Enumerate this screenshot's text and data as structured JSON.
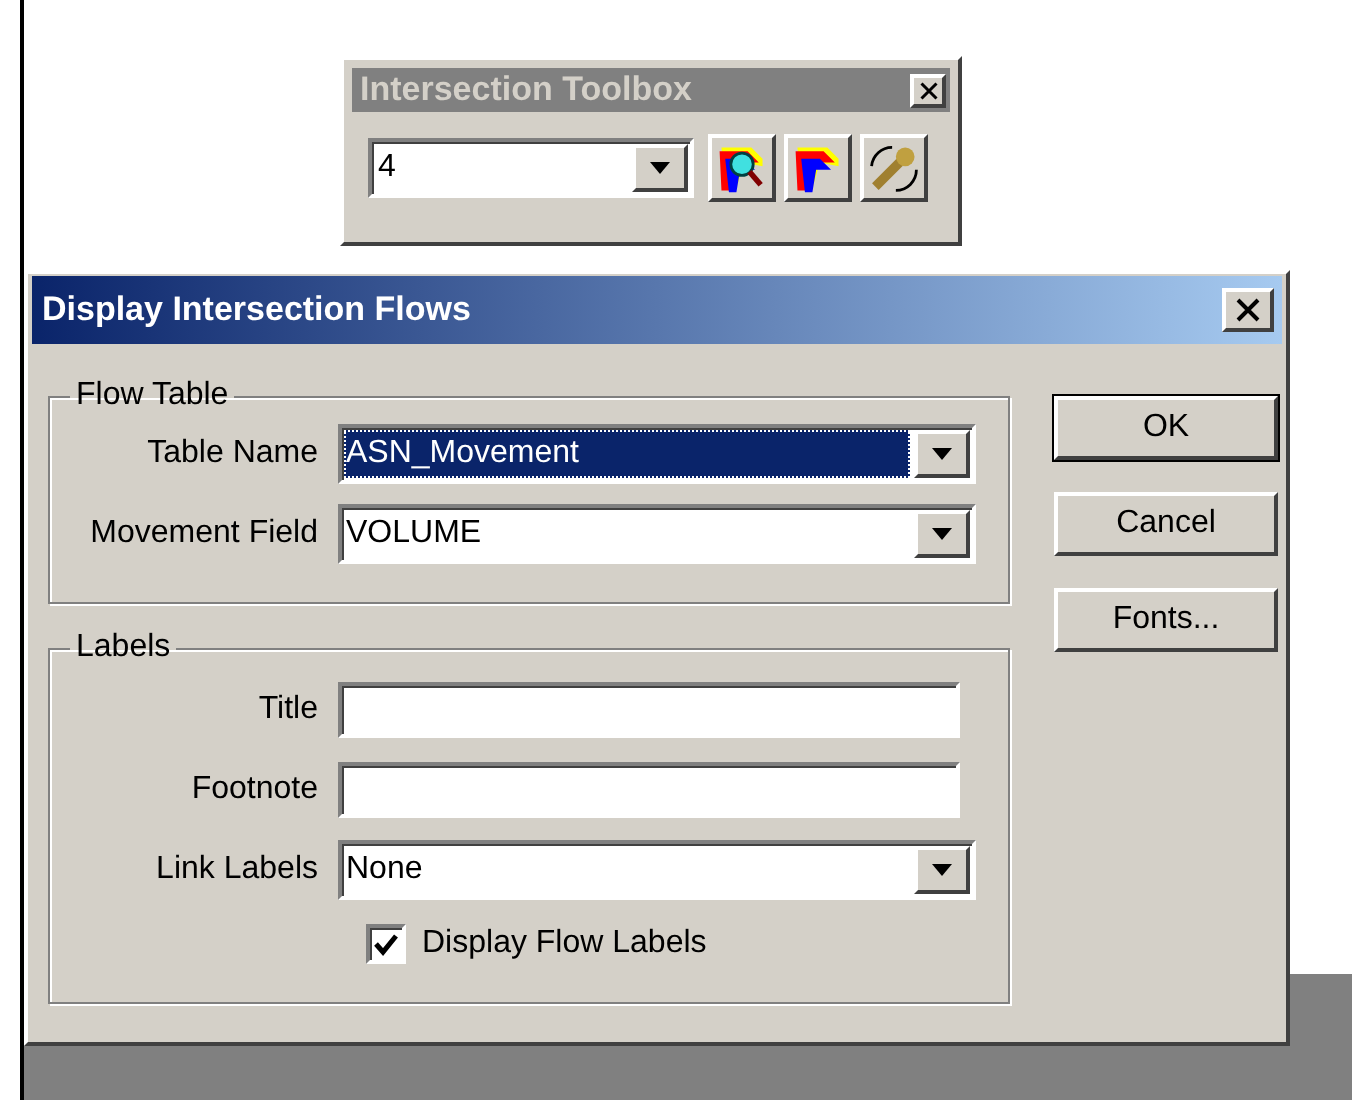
{
  "toolbox": {
    "title": "Intersection Toolbox",
    "combo": {
      "value": "4"
    }
  },
  "dialog": {
    "title": "Display Intersection Flows",
    "flow_table": {
      "legend": "Flow Table",
      "fields": [
        {
          "kind": "combo",
          "label": "Table Name",
          "value": "ASN_Movement",
          "focused": true
        },
        {
          "kind": "combo",
          "label": "Movement Field",
          "value": "VOLUME",
          "focused": false
        }
      ]
    },
    "labels": {
      "legend": "Labels",
      "fields": [
        {
          "kind": "text",
          "label": "Title"
        },
        {
          "kind": "text",
          "label": "Footnote"
        },
        {
          "kind": "combo",
          "label": "Link Labels",
          "value": "None",
          "focused": false
        }
      ],
      "checkbox": {
        "label": "Display Flow Labels",
        "checked": true
      }
    },
    "buttons": [
      {
        "label": "OK",
        "default": true
      },
      {
        "label": "Cancel",
        "default": false
      },
      {
        "label": "Fonts...",
        "default": false
      }
    ]
  }
}
